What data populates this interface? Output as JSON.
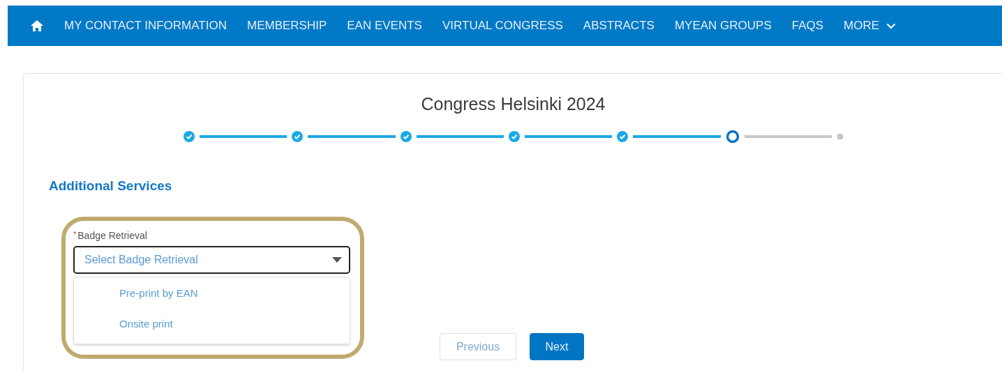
{
  "nav": {
    "items": [
      "MY CONTACT INFORMATION",
      "MEMBERSHIP",
      "EAN EVENTS",
      "VIRTUAL CONGRESS",
      "ABSTRACTS",
      "MYEAN GROUPS",
      "FAQS"
    ],
    "more": "MORE"
  },
  "title": "Congress Helsinki 2024",
  "steps": [
    {
      "done": true,
      "current": false
    },
    {
      "done": true,
      "current": false
    },
    {
      "done": true,
      "current": false
    },
    {
      "done": true,
      "current": false
    },
    {
      "done": true,
      "current": false
    },
    {
      "done": false,
      "current": true
    },
    {
      "done": false,
      "current": false
    }
  ],
  "section": "Additional Services",
  "field": {
    "label": "Badge Retrieval",
    "required_mark": "*",
    "placeholder": "Select Badge Retrieval",
    "expanded": true,
    "options": [
      "Pre-print by EAN",
      "Onsite print"
    ]
  },
  "buttons": {
    "previous": "Previous",
    "next": "Next"
  }
}
